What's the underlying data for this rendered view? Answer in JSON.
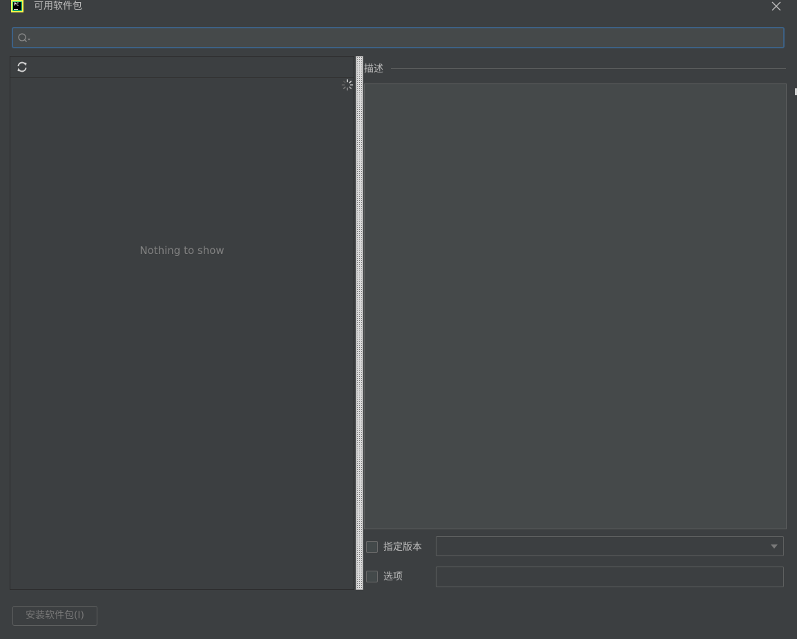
{
  "window": {
    "title": "可用软件包",
    "app_icon_text": "PC"
  },
  "search": {
    "value": "",
    "placeholder": ""
  },
  "package_list": {
    "empty_text": "Nothing to show",
    "loading": true
  },
  "description": {
    "label": "描述",
    "content": ""
  },
  "options": {
    "specify_version_label": "指定版本",
    "specify_version_checked": false,
    "version_value": "",
    "options_label": "选项",
    "options_checked": false,
    "options_value": ""
  },
  "footer": {
    "install_button_label": "安装软件包(I)",
    "install_enabled": false
  },
  "colors": {
    "background": "#3c3f41",
    "field_background": "#45494a",
    "focus_border": "#3d6185",
    "text": "#bbbbbb",
    "muted_text": "#808080"
  },
  "icons": [
    "pycharm-app-icon",
    "close-icon",
    "search-icon",
    "refresh-icon",
    "loading-spinner-icon",
    "chevron-down-icon"
  ]
}
